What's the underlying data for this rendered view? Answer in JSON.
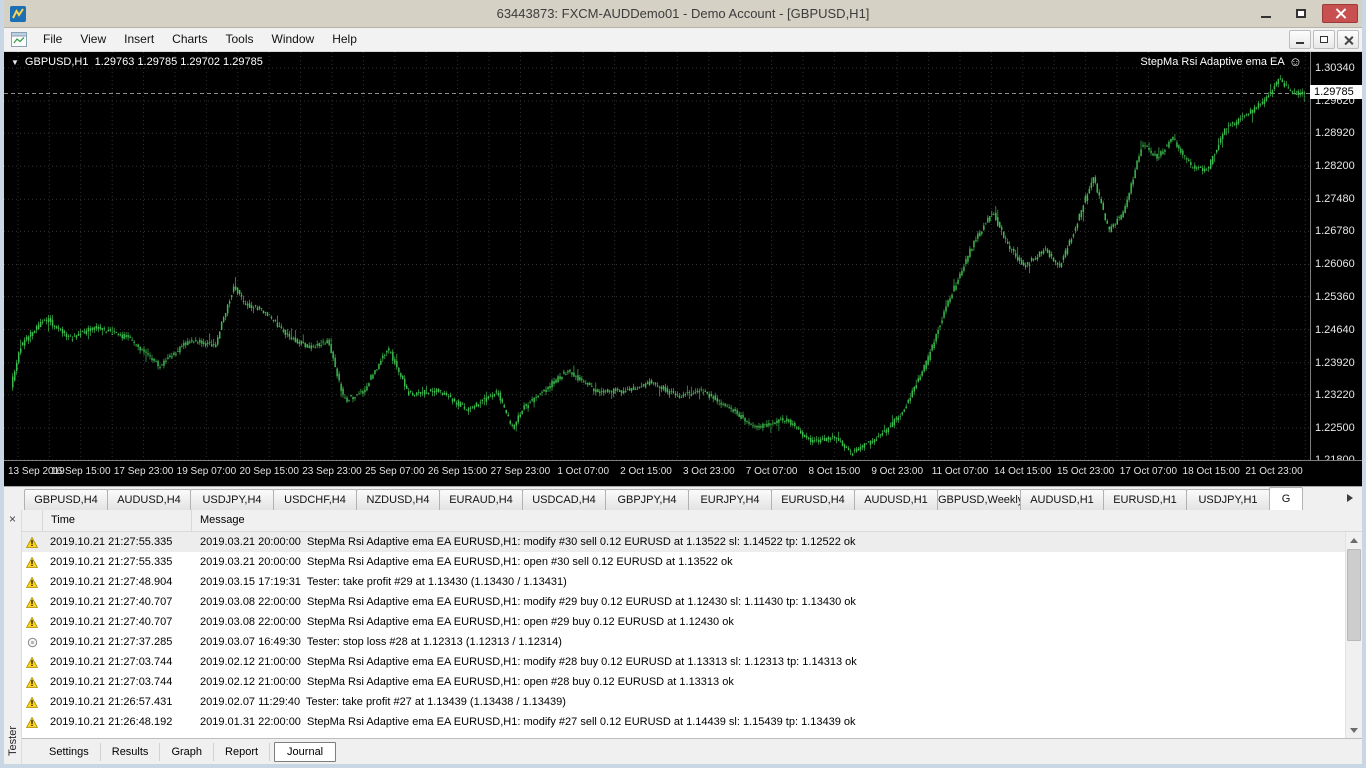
{
  "icons": {
    "dropdown_arrow": "▼",
    "ea_smiley": "☺",
    "close": "×"
  },
  "window": {
    "title": "63443873: FXCM-AUDDemo01 - Demo Account - [GBPUSD,H1]"
  },
  "menu": {
    "items": [
      "File",
      "View",
      "Insert",
      "Charts",
      "Tools",
      "Window",
      "Help"
    ]
  },
  "chart": {
    "symbol_info": "GBPUSD,H1  1.29763 1.29785 1.29702 1.29785",
    "ea_name": "StepMa Rsi Adaptive ema EA",
    "current_price": "1.29785"
  },
  "chart_data": {
    "type": "candlestick",
    "symbol": "GBPUSD",
    "timeframe": "H1",
    "title": "GBPUSD,H1",
    "visible_ohlc": {
      "open": 1.29763,
      "high": 1.29785,
      "low": 1.29702,
      "close": 1.29785
    },
    "current_price": 1.29785,
    "y_ticks": [
      1.3034,
      1.2962,
      1.2892,
      1.282,
      1.2748,
      1.2678,
      1.2606,
      1.2536,
      1.2464,
      1.2392,
      1.2322,
      1.225,
      1.218
    ],
    "x_ticks": [
      "13 Sep 2019",
      "16 Sep 15:00",
      "17 Sep 23:00",
      "19 Sep 07:00",
      "20 Sep 15:00",
      "23 Sep 23:00",
      "25 Sep 07:00",
      "26 Sep 15:00",
      "27 Sep 23:00",
      "1 Oct 07:00",
      "2 Oct 15:00",
      "3 Oct 23:00",
      "7 Oct 07:00",
      "8 Oct 15:00",
      "9 Oct 23:00",
      "11 Oct 07:00",
      "14 Oct 15:00",
      "15 Oct 23:00",
      "17 Oct 07:00",
      "18 Oct 15:00",
      "21 Oct 23:00"
    ],
    "ylim": [
      1.218,
      1.3069
    ],
    "grid": true,
    "legend_position": "none",
    "background": "#000000",
    "candle_color": "#3dbb4e",
    "num_candles": 650,
    "seed": 20191021,
    "price_path_anchors": [
      [
        0.0,
        1.234
      ],
      [
        0.008,
        1.243
      ],
      [
        0.027,
        1.249
      ],
      [
        0.046,
        1.2445
      ],
      [
        0.065,
        1.247
      ],
      [
        0.092,
        1.2445
      ],
      [
        0.115,
        1.2385
      ],
      [
        0.138,
        1.244
      ],
      [
        0.158,
        1.243
      ],
      [
        0.173,
        1.256
      ],
      [
        0.181,
        1.252
      ],
      [
        0.196,
        1.2505
      ],
      [
        0.215,
        1.245
      ],
      [
        0.231,
        1.2425
      ],
      [
        0.246,
        1.244
      ],
      [
        0.258,
        1.231
      ],
      [
        0.273,
        1.233
      ],
      [
        0.292,
        1.2425
      ],
      [
        0.308,
        1.2325
      ],
      [
        0.331,
        1.233
      ],
      [
        0.354,
        1.229
      ],
      [
        0.377,
        1.233
      ],
      [
        0.388,
        1.225
      ],
      [
        0.396,
        1.229
      ],
      [
        0.412,
        1.233
      ],
      [
        0.431,
        1.2375
      ],
      [
        0.454,
        1.233
      ],
      [
        0.477,
        1.233
      ],
      [
        0.496,
        1.235
      ],
      [
        0.515,
        1.232
      ],
      [
        0.535,
        1.233
      ],
      [
        0.554,
        1.23
      ],
      [
        0.577,
        1.225
      ],
      [
        0.6,
        1.227
      ],
      [
        0.619,
        1.222
      ],
      [
        0.638,
        1.223
      ],
      [
        0.65,
        1.2195
      ],
      [
        0.672,
        1.223
      ],
      [
        0.69,
        1.228
      ],
      [
        0.71,
        1.24
      ],
      [
        0.725,
        1.252
      ],
      [
        0.745,
        1.265
      ],
      [
        0.76,
        1.272
      ],
      [
        0.772,
        1.265
      ],
      [
        0.785,
        1.26
      ],
      [
        0.8,
        1.264
      ],
      [
        0.812,
        1.26
      ],
      [
        0.825,
        1.269
      ],
      [
        0.838,
        1.28
      ],
      [
        0.85,
        1.268
      ],
      [
        0.862,
        1.272
      ],
      [
        0.876,
        1.287
      ],
      [
        0.888,
        1.284
      ],
      [
        0.9,
        1.288
      ],
      [
        0.914,
        1.282
      ],
      [
        0.926,
        1.281
      ],
      [
        0.94,
        1.29
      ],
      [
        0.955,
        1.293
      ],
      [
        0.97,
        1.296
      ],
      [
        0.982,
        1.301
      ],
      [
        0.992,
        1.298
      ],
      [
        1.0,
        1.29785
      ]
    ]
  },
  "symbol_tabs": {
    "items": [
      {
        "label": "GBPUSD,H4"
      },
      {
        "label": "AUDUSD,H4"
      },
      {
        "label": "USDJPY,H4"
      },
      {
        "label": "USDCHF,H4"
      },
      {
        "label": "NZDUSD,H4"
      },
      {
        "label": "EURAUD,H4"
      },
      {
        "label": "USDCAD,H4"
      },
      {
        "label": "GBPJPY,H4"
      },
      {
        "label": "EURJPY,H4"
      },
      {
        "label": "EURUSD,H4"
      },
      {
        "label": "AUDUSD,H1"
      },
      {
        "label": "GBPUSD,Weekly"
      },
      {
        "label": "AUDUSD,H1"
      },
      {
        "label": "EURUSD,H1"
      },
      {
        "label": "USDJPY,H1"
      },
      {
        "label": "G",
        "active": true
      }
    ]
  },
  "tester": {
    "panel_label": "Tester",
    "columns": [
      "Time",
      "Message"
    ],
    "rows": [
      {
        "icon": "warning",
        "time": "2019.10.21 21:27:55.335",
        "message": "2019.03.21 20:00:00  StepMa Rsi Adaptive ema EA EURUSD,H1: modify #30 sell 0.12 EURUSD at 1.13522 sl: 1.14522 tp: 1.12522 ok"
      },
      {
        "icon": "warning",
        "time": "2019.10.21 21:27:55.335",
        "message": "2019.03.21 20:00:00  StepMa Rsi Adaptive ema EA EURUSD,H1: open #30 sell 0.12 EURUSD at 1.13522 ok"
      },
      {
        "icon": "warning",
        "time": "2019.10.21 21:27:48.904",
        "message": "2019.03.15 17:19:31  Tester: take profit #29 at 1.13430 (1.13430 / 1.13431)"
      },
      {
        "icon": "warning",
        "time": "2019.10.21 21:27:40.707",
        "message": "2019.03.08 22:00:00  StepMa Rsi Adaptive ema EA EURUSD,H1: modify #29 buy 0.12 EURUSD at 1.12430 sl: 1.11430 tp: 1.13430 ok"
      },
      {
        "icon": "warning",
        "time": "2019.10.21 21:27:40.707",
        "message": "2019.03.08 22:00:00  StepMa Rsi Adaptive ema EA EURUSD,H1: open #29 buy 0.12 EURUSD at 1.12430 ok"
      },
      {
        "icon": "stop",
        "time": "2019.10.21 21:27:37.285",
        "message": "2019.03.07 16:49:30  Tester: stop loss #28 at 1.12313 (1.12313 / 1.12314)"
      },
      {
        "icon": "warning",
        "time": "2019.10.21 21:27:03.744",
        "message": "2019.02.12 21:00:00  StepMa Rsi Adaptive ema EA EURUSD,H1: modify #28 buy 0.12 EURUSD at 1.13313 sl: 1.12313 tp: 1.14313 ok"
      },
      {
        "icon": "warning",
        "time": "2019.10.21 21:27:03.744",
        "message": "2019.02.12 21:00:00  StepMa Rsi Adaptive ema EA EURUSD,H1: open #28 buy 0.12 EURUSD at 1.13313 ok"
      },
      {
        "icon": "warning",
        "time": "2019.10.21 21:26:57.431",
        "message": "2019.02.07 11:29:40  Tester: take profit #27 at 1.13439 (1.13438 / 1.13439)"
      },
      {
        "icon": "warning",
        "time": "2019.10.21 21:26:48.192",
        "message": "2019.01.31 22:00:00  StepMa Rsi Adaptive ema EA EURUSD,H1: modify #27 sell 0.12 EURUSD at 1.14439 sl: 1.15439 tp: 1.13439 ok"
      }
    ],
    "tabs": [
      {
        "label": "Settings"
      },
      {
        "label": "Results"
      },
      {
        "label": "Graph"
      },
      {
        "label": "Report"
      },
      {
        "label": "Journal",
        "active": true
      }
    ]
  },
  "colors": {
    "candle_green": "#3dbb4e",
    "chart_background": "#000000",
    "warning_yellow": "#ffd21e",
    "close_button_red": "#c85050",
    "titlebar_beige": "#d5d1c4"
  }
}
